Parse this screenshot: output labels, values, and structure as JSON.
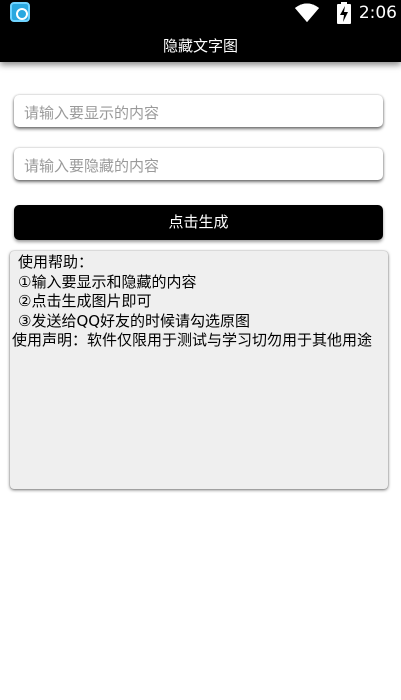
{
  "status_bar": {
    "time": "2:06",
    "icons": [
      "app-icon",
      "wifi-icon",
      "battery-charging-icon"
    ]
  },
  "app_bar": {
    "title": "隐藏文字图"
  },
  "form": {
    "display_placeholder": "请输入要显示的内容",
    "display_value": "",
    "hidden_placeholder": "请输入要隐藏的内容",
    "hidden_value": "",
    "generate_label": "点击生成"
  },
  "help": {
    "heading": "使用帮助：",
    "steps": [
      "①输入要显示和隐藏的内容",
      "②点击生成图片即可",
      "③发送给QQ好友的时候请勾选原图"
    ],
    "disclaimer": "使用声明：软件仅限用于测试与学习切勿用于其他用途"
  },
  "colors": {
    "bar_background": "#000000",
    "button_background": "#000000",
    "panel_background": "#efefef",
    "placeholder_text": "#9a9a9a"
  }
}
